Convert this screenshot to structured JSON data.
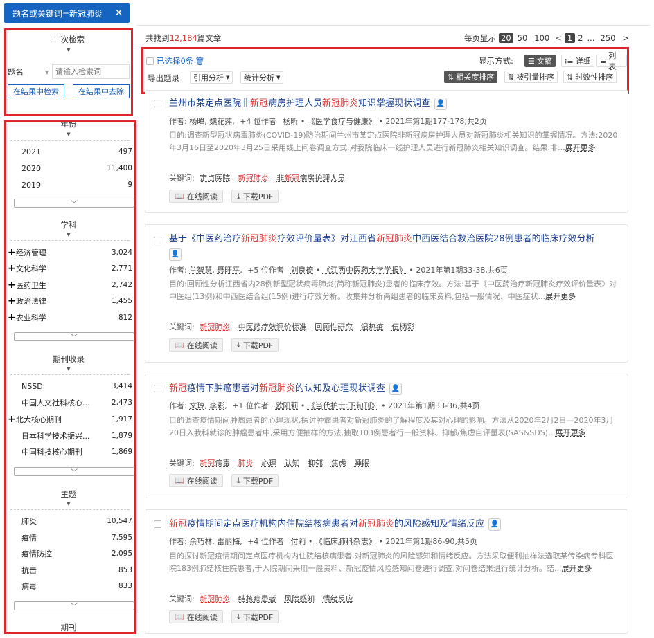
{
  "filter_chip": {
    "label": "题名或关键词=新冠肺炎",
    "close": "×"
  },
  "sidebar": {
    "secondary": {
      "title": "二次检索",
      "field": "题名",
      "placeholder": "请输入检索词",
      "in_results": "在结果中检索",
      "remove_from": "在结果中去除"
    },
    "year": {
      "title": "年份",
      "items": [
        {
          "label": "2021",
          "count": "497"
        },
        {
          "label": "2020",
          "count": "11,400"
        },
        {
          "label": "2019",
          "count": "9"
        }
      ]
    },
    "subject": {
      "title": "学科",
      "items": [
        {
          "label": "经济管理",
          "count": "3,024"
        },
        {
          "label": "文化科学",
          "count": "2,771"
        },
        {
          "label": "医药卫生",
          "count": "2,742"
        },
        {
          "label": "政治法律",
          "count": "1,455"
        },
        {
          "label": "农业科学",
          "count": "812"
        }
      ]
    },
    "collection": {
      "title": "期刊收录",
      "items": [
        {
          "label": "NSSD",
          "count": "3,414"
        },
        {
          "label": "中国人文社科核心...",
          "count": "2,473"
        },
        {
          "label": "北大核心期刊",
          "count": "1,917"
        },
        {
          "label": "日本科学技术振兴...",
          "count": "1,879"
        },
        {
          "label": "中国科技核心期刊",
          "count": "1,869"
        }
      ]
    },
    "topic": {
      "title": "主题",
      "items": [
        {
          "label": "肺炎",
          "count": "10,547"
        },
        {
          "label": "疫情",
          "count": "7,595"
        },
        {
          "label": "疫情防控",
          "count": "2,095"
        },
        {
          "label": "抗击",
          "count": "853"
        },
        {
          "label": "病毒",
          "count": "833"
        }
      ]
    },
    "journal": {
      "title": "期刊"
    }
  },
  "results": {
    "found_prefix": "共找到",
    "found_count": "12,184",
    "found_suffix": "篇文章",
    "per_page_label": "每页显示",
    "per_page_options": [
      "20",
      "50",
      "100"
    ],
    "pages": [
      "1",
      "2",
      "...",
      "250",
      ">"
    ]
  },
  "toolbar": {
    "selected": "已选择0条",
    "export": "导出题录",
    "citation": "引用分析",
    "stats": "统计分析",
    "display_label": "显示方式:",
    "views": [
      "文摘",
      "详细",
      "列表"
    ],
    "sorts": [
      "相关度排序",
      "被引量排序",
      "时效性排序"
    ]
  },
  "labels": {
    "authors_prefix": "作者:",
    "keywords_prefix": "关键词:",
    "expand": "展开更多",
    "read_online": "在线阅读",
    "download_pdf": "下载PDF"
  },
  "articles": [
    {
      "title_parts": [
        "兰州市某定点医院非",
        "新冠",
        "病房护理人员",
        "新冠肺炎",
        "知识掌握现状调查"
      ],
      "author1": "杨暐",
      "author2": "魏花萍",
      "more_authors": "+4 位作者",
      "author3": "杨昕",
      "journal": "《医学食疗与健康》",
      "issue": "2021年第1期177-178,共2页",
      "abstract": "目的:调查新型冠状病毒肺炎(COVID-19)防治期间兰州市某定点医院非新冠病房护理人员对新冠肺炎相关知识的掌握情况。方法:2020年3月16日至2020年3月25日采用线上问卷调查方式,对我院临床一线护理人员进行新冠肺炎相关知识调查。结果:非...",
      "keywords": [
        {
          "t": "定点医院",
          "h": false
        },
        {
          "t": "新冠肺炎",
          "h": true
        }
      ],
      "kw_mixed": [
        "非",
        "新冠",
        "病房护理人员"
      ]
    },
    {
      "title_parts": [
        "基于《中医药治疗",
        "新冠肺炎",
        "疗效评价量表》对江西省",
        "新冠肺炎",
        "中西医结合救治医院28例患者的临床疗效分析"
      ],
      "author1": "兰智慧",
      "author2": "聂旺平",
      "more_authors": "+5 位作者",
      "author3": "刘良徛",
      "journal": "《江西中医药大学学报》",
      "issue": "2021年第1期33-38,共6页",
      "abstract": "目的:回顾性分析江西省内28例新型冠状病毒肺炎(简称新冠肺炎)患者的临床疗效。方法:基于《中医药治疗新冠肺炎疗效评价量表》对中医组(13例)和中西医结合组(15例)进行疗效分析。收集并分析两组患者的临床资料,包括一般情况、中医症状...",
      "keywords": [
        {
          "t": "新冠肺炎",
          "h": true
        },
        {
          "t": "中医药疗效评价标准",
          "h": false
        },
        {
          "t": "回顾性研究",
          "h": false
        },
        {
          "t": "湿热疫",
          "h": false
        },
        {
          "t": "伍柄彩",
          "h": false
        }
      ]
    },
    {
      "title_parts": [
        "新冠",
        "疫情下肿瘤患者对",
        "新冠肺炎",
        "的认知及心理现状调查"
      ],
      "author1": "文玲",
      "author2": "李彩",
      "more_authors": "+1 位作者",
      "author3": "欧阳莉",
      "journal": "《当代护士:下旬刊》",
      "issue": "2021年第1期33-36,共4页",
      "abstract": "目的调查疫情期间肿瘤患者的心理现状,探讨肿瘤患者对新冠肺炎的了解程度及其对心理的影响。方法从2020年2月2日—2020年3月20日入我科就诊的肿瘤患者中,采用方便抽样的方法,抽取103例患者行一般资料、抑郁/焦虑自评量表(SAS&SDS)...",
      "keywords": [
        {
          "t": "新冠病毒",
          "h": false
        },
        {
          "t": "肺炎",
          "h": true
        },
        {
          "t": "心理",
          "h": false
        },
        {
          "t": "认知",
          "h": false
        },
        {
          "t": "抑郁",
          "h": false
        },
        {
          "t": "焦虑",
          "h": false
        },
        {
          "t": "睡眠",
          "h": false
        }
      ]
    },
    {
      "title_parts": [
        "新冠",
        "疫情期间定点医疗机构内住院结核病患者对",
        "新冠肺炎",
        "的风险感知及情绪反应"
      ],
      "author1": "余巧林",
      "author2": "雷丽梅",
      "more_authors": "+4 位作者",
      "author3": "付莉",
      "journal": "《临床肺科杂志》",
      "issue": "2021年第1期86-90,共5页",
      "abstract": "目的探讨新冠疫情期间定点医疗机构内住院结核病患者,对新冠肺炎的风险感知和情绪反应。方法采取便利抽样法选取某传染病专科医院183例肺结核住院患者,于入院期间采用一般资料、新冠疫情风险感知问卷进行调查,对问卷结果进行统计分析。结...",
      "keywords": [
        {
          "t": "新冠肺炎",
          "h": true
        },
        {
          "t": "结核病患者",
          "h": false
        },
        {
          "t": "风险感知",
          "h": false
        },
        {
          "t": "情绪反应",
          "h": false
        }
      ]
    }
  ]
}
